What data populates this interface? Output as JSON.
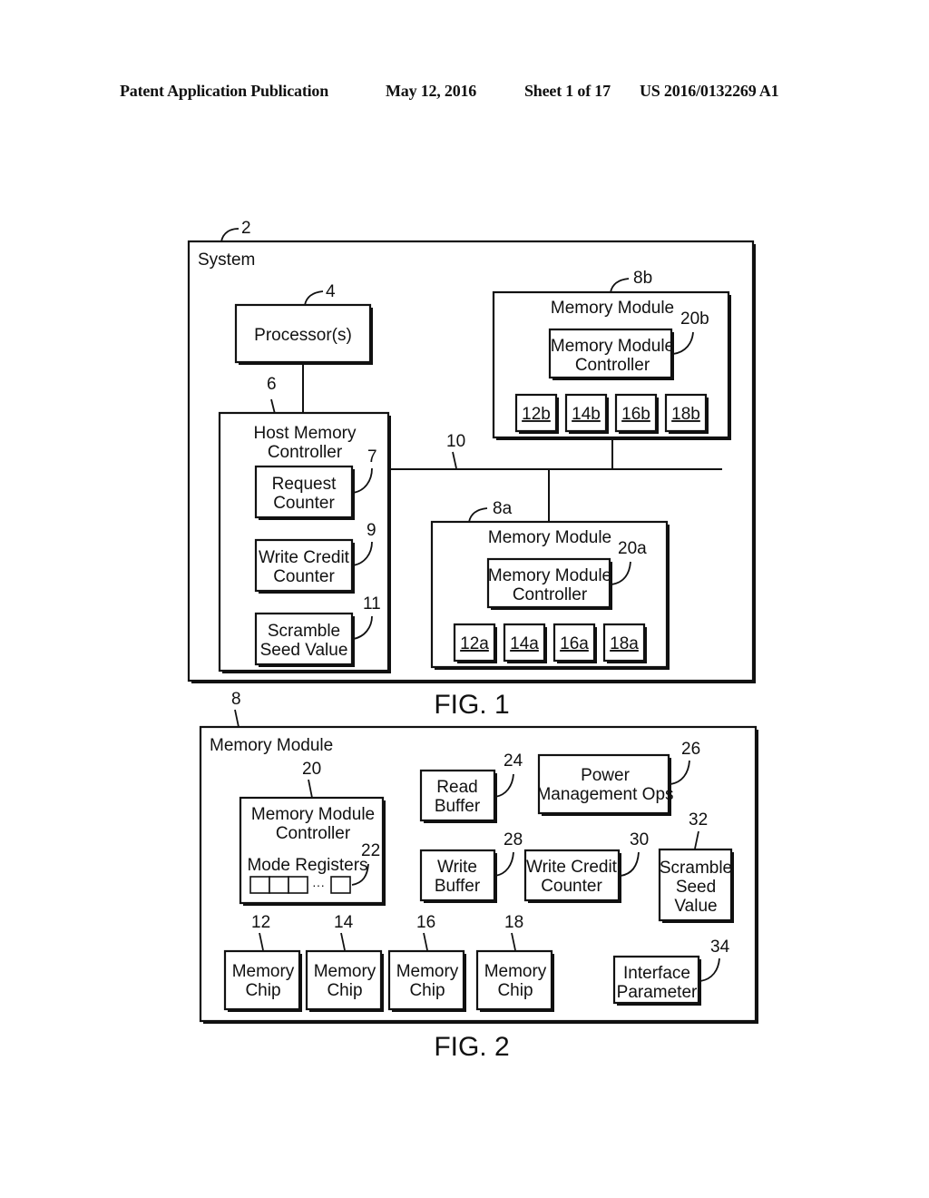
{
  "header": {
    "left": "Patent Application Publication",
    "date": "May 12, 2016",
    "sheet": "Sheet 1 of 17",
    "pub_number": "US 2016/0132269 A1"
  },
  "fig1": {
    "caption": "FIG. 1",
    "system": {
      "ref": "2",
      "label": "System"
    },
    "processor": {
      "ref": "4",
      "label": "Processor(s)"
    },
    "host_memory_controller": {
      "ref": "6",
      "label_line1": "Host Memory",
      "label_line2": "Controller",
      "request_counter": {
        "ref": "7",
        "line1": "Request",
        "line2": "Counter"
      },
      "write_credit_counter": {
        "ref": "9",
        "line1": "Write Credit",
        "line2": "Counter"
      },
      "scramble_seed_value": {
        "ref": "11",
        "line1": "Scramble",
        "line2": "Seed Value"
      }
    },
    "bus": {
      "ref": "10"
    },
    "memory_module_b": {
      "ref": "8b",
      "label": "Memory Module",
      "controller": {
        "ref": "20b",
        "line1": "Memory Module",
        "line2": "Controller"
      },
      "chips": [
        "12b",
        "14b",
        "16b",
        "18b"
      ]
    },
    "memory_module_a": {
      "ref": "8a",
      "label": "Memory Module",
      "controller": {
        "ref": "20a",
        "line1": "Memory Module",
        "line2": "Controller"
      },
      "chips": [
        "12a",
        "14a",
        "16a",
        "18a"
      ]
    }
  },
  "fig2": {
    "caption": "FIG. 2",
    "memory_module": {
      "ref": "8",
      "label": "Memory Module"
    },
    "controller": {
      "ref": "20",
      "line1": "Memory Module",
      "line2": "Controller"
    },
    "mode_registers": {
      "ref": "22",
      "label": "Mode Registers",
      "ellipsis": "···"
    },
    "read_buffer": {
      "ref": "24",
      "line1": "Read",
      "line2": "Buffer"
    },
    "power_management": {
      "ref": "26",
      "line1": "Power",
      "line2": "Management Ops"
    },
    "write_buffer": {
      "ref": "28",
      "line1": "Write",
      "line2": "Buffer"
    },
    "write_credit_counter": {
      "ref": "30",
      "line1": "Write Credit",
      "line2": "Counter"
    },
    "scramble_seed_value": {
      "ref": "32",
      "line1": "Scramble",
      "line2": "Seed",
      "line3": "Value"
    },
    "interface_parameter": {
      "ref": "34",
      "line1": "Interface",
      "line2": "Parameter"
    },
    "memory_chips": [
      {
        "ref": "12",
        "line1": "Memory",
        "line2": "Chip"
      },
      {
        "ref": "14",
        "line1": "Memory",
        "line2": "Chip"
      },
      {
        "ref": "16",
        "line1": "Memory",
        "line2": "Chip"
      },
      {
        "ref": "18",
        "line1": "Memory",
        "line2": "Chip"
      }
    ]
  }
}
